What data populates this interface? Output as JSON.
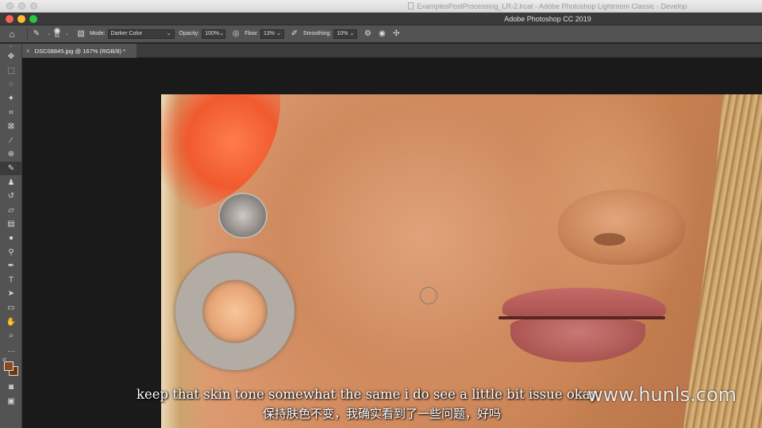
{
  "outer_window": {
    "title": "ExamplesPostProcessing_LR-2.lrcat - Adobe Photoshop Lightroom Classic - Develop"
  },
  "app": {
    "title": "Adobe Photoshop CC 2019"
  },
  "options_bar": {
    "brush_size": "51",
    "mode_label": "Mode:",
    "mode_value": "Darker Color",
    "opacity_label": "Opacity:",
    "opacity_value": "100%",
    "flow_label": "Flow:",
    "flow_value": "13%",
    "smoothing_label": "Smoothing:",
    "smoothing_value": "10%"
  },
  "document_tab": {
    "label": "DSC08845.jpg @ 167% (RGB/8) *",
    "close": "×"
  },
  "toolbar": {
    "tools": [
      "move-tool",
      "marquee-tool",
      "lasso-tool",
      "quick-selection-tool",
      "crop-tool",
      "frame-tool",
      "eyedropper-tool",
      "healing-brush-tool",
      "brush-tool",
      "clone-stamp-tool",
      "history-brush-tool",
      "eraser-tool",
      "gradient-tool",
      "blur-tool",
      "dodge-tool",
      "pen-tool",
      "type-tool",
      "path-selection-tool",
      "rectangle-tool",
      "hand-tool",
      "zoom-tool",
      "more-tools"
    ],
    "active_tool": "brush-tool",
    "foreground_color": "#8c4a1c",
    "background_color": "#6a3512"
  },
  "subtitles": {
    "english": "keep that skin tone somewhat the same i do see a little bit issue okay",
    "chinese": "保持肤色不变，我确实看到了一些问题，好吗"
  },
  "watermark": "www.hunls.com"
}
